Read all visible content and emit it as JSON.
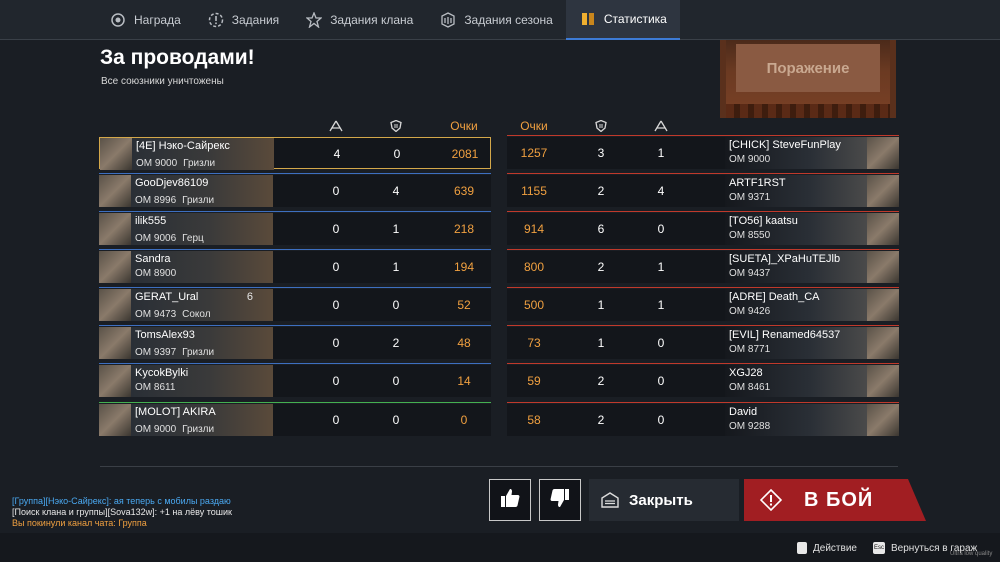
{
  "tabs": [
    {
      "label": "Награда",
      "icon": "reward-icon",
      "active": false
    },
    {
      "label": "Задания",
      "icon": "tasks-icon",
      "active": false
    },
    {
      "label": "Задания клана",
      "icon": "clan-tasks-icon",
      "active": false
    },
    {
      "label": "Задания сезона",
      "icon": "season-tasks-icon",
      "active": false
    },
    {
      "label": "Статистика",
      "icon": "statistics-icon",
      "active": true
    }
  ],
  "header": {
    "title": "За проводами!",
    "subtitle": "Все союзники уничтожены"
  },
  "result_banner": "Поражение",
  "columns": {
    "kills_icon": "kills-icon",
    "assists_icon": "shield-icon",
    "score_label": "Очки"
  },
  "allies": [
    {
      "name": "[4E] Нэко-Сайрекс",
      "om": "ОМ 9000",
      "clan": "Гризли",
      "kills": "4",
      "assists": "0",
      "score": "2081"
    },
    {
      "name": "GooDjev86109",
      "om": "ОМ 8996",
      "clan": "Гризли",
      "kills": "0",
      "assists": "4",
      "score": "639"
    },
    {
      "name": "ilik555",
      "om": "ОМ 9006",
      "clan": "Герц",
      "kills": "0",
      "assists": "1",
      "score": "218"
    },
    {
      "name": "Sandra",
      "om": "ОМ 8900",
      "clan": "",
      "kills": "0",
      "assists": "1",
      "score": "194"
    },
    {
      "name": "GERAT_Ural",
      "om": "ОМ 9473",
      "clan": "Сокол",
      "extra": "6",
      "kills": "0",
      "assists": "0",
      "score": "52"
    },
    {
      "name": "TomsAlex93",
      "om": "ОМ 9397",
      "clan": "Гризли",
      "kills": "0",
      "assists": "2",
      "score": "48"
    },
    {
      "name": "KycokBylki",
      "om": "ОМ 8611",
      "clan": "",
      "kills": "0",
      "assists": "0",
      "score": "14"
    },
    {
      "name": "[MOLOT] AKIRA",
      "om": "ОМ 9000",
      "clan": "Гризли",
      "kills": "0",
      "assists": "0",
      "score": "0"
    }
  ],
  "enemies": [
    {
      "name": "[CHICK] SteveFunPlay",
      "om": "ОМ 9000",
      "score": "1257",
      "assists": "3",
      "kills": "1"
    },
    {
      "name": "ARTF1RST",
      "om": "ОМ 9371",
      "score": "1155",
      "assists": "2",
      "kills": "4"
    },
    {
      "name": "[TO56] kaatsu",
      "om": "ОМ 8550",
      "score": "914",
      "assists": "6",
      "kills": "0"
    },
    {
      "name": "[SUETA]_XPaHuTEJlb",
      "om": "ОМ 9437",
      "score": "800",
      "assists": "2",
      "kills": "1"
    },
    {
      "name": "[ADRE] Death_CA",
      "om": "ОМ 9426",
      "score": "500",
      "assists": "1",
      "kills": "1"
    },
    {
      "name": "[EVIL] Renamed64537",
      "om": "ОМ 8771",
      "score": "73",
      "assists": "1",
      "kills": "0"
    },
    {
      "name": "XGJ28",
      "om": "ОМ 8461",
      "score": "59",
      "assists": "2",
      "kills": "0"
    },
    {
      "name": "David",
      "om": "ОМ 9288",
      "score": "58",
      "assists": "2",
      "kills": "0"
    }
  ],
  "chat": [
    "[Группа][Нэко-Сайрекс]: ая теперь с мобилы раздаю",
    "[Поиск клана и группы][Sova132w]: +1 на лёву тошик",
    "Вы покинули канал чата: Группа"
  ],
  "buttons": {
    "like_icon": "thumbs-up-icon",
    "dislike_icon": "thumbs-down-icon",
    "close_label": "Закрыть",
    "fight_label": "В БОЙ"
  },
  "footer": {
    "action_label": "Действие",
    "garage_label": "Вернуться в гараж",
    "esc_key": "Esc",
    "quality": "Ultra low quality"
  },
  "colors": {
    "accent_blue": "#3d6fc0",
    "accent_red": "#c0392b",
    "score_orange": "#f0a040",
    "fight_red": "#a11e22"
  }
}
